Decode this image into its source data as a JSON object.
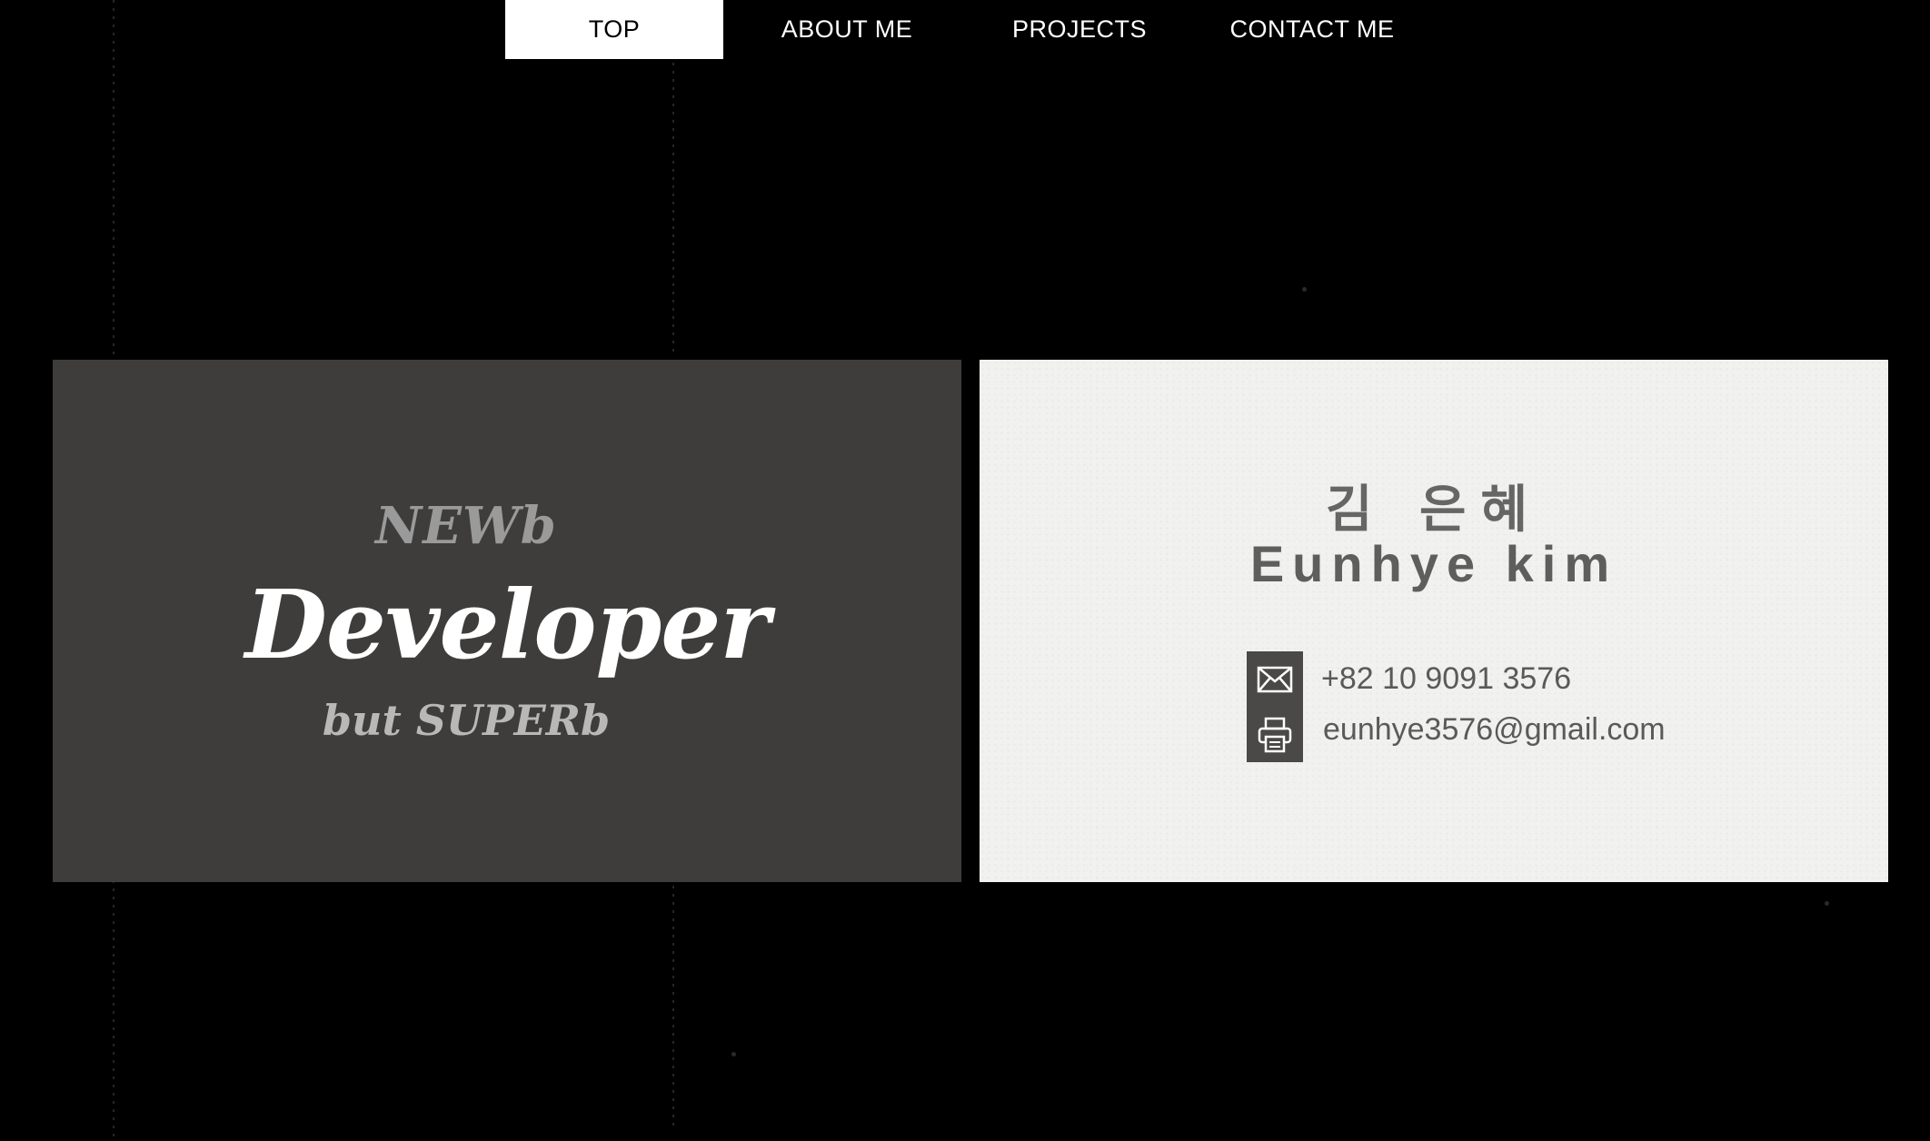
{
  "nav": {
    "items": [
      {
        "label": "TOP",
        "active": true
      },
      {
        "label": "ABOUT ME",
        "active": false
      },
      {
        "label": "PROJECTS",
        "active": false
      },
      {
        "label": "CONTACT ME",
        "active": false
      }
    ]
  },
  "front_card": {
    "tagline_top": "NEWb",
    "tagline_main": "Developer",
    "tagline_bottom": "but SUPERb",
    "background_color": "#3e3d3c"
  },
  "back_card": {
    "korean_name": "김 은혜",
    "english_name": "Eunhye kim",
    "phone": "+82 10 9091 3576",
    "email": "eunhye3576@gmail.com",
    "icons": [
      "envelope-icon",
      "printer-icon"
    ],
    "background_color": "#f1f1ef"
  },
  "colors": {
    "page_background": "#000000",
    "nav_active_bg": "#ffffff",
    "nav_text": "#ffffff"
  }
}
